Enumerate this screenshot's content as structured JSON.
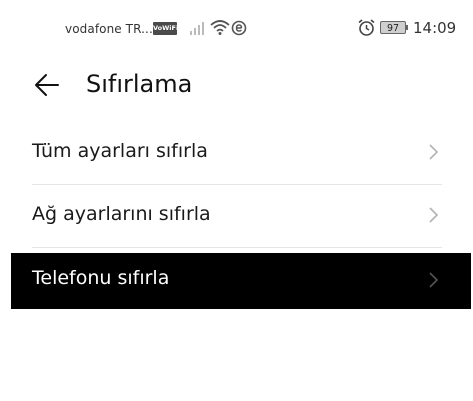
{
  "status_bar": {
    "carrier": "vodafone TR...",
    "volte_label": "VoWiFi",
    "battery_level": "97",
    "time": "14:09",
    "icons": [
      "signal-icon",
      "wifi-icon",
      "data-saver-icon",
      "alarm-icon",
      "battery-icon"
    ]
  },
  "header": {
    "title": "Sıfırlama",
    "back_icon": "back-arrow-icon"
  },
  "menu": {
    "items": [
      {
        "label": "Tüm ayarları sıfırla",
        "selected": false
      },
      {
        "label": "Ağ ayarlarını sıfırla",
        "selected": false
      },
      {
        "label": "Telefonu sıfırla",
        "selected": true
      }
    ],
    "chevron_icon": "chevron-right-icon"
  },
  "colors": {
    "background": "#ffffff",
    "selected_row": "#000000",
    "text": "#111111",
    "chevron": "#b3b3b3",
    "divider": "#e6e6e6"
  }
}
